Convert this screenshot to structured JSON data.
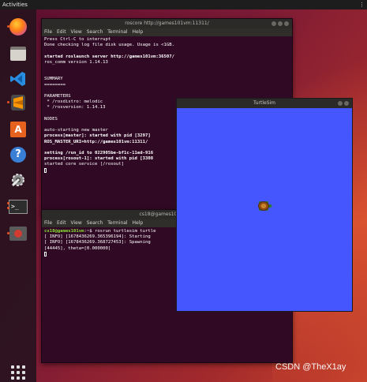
{
  "topbar": {
    "activities": "Activities",
    "tray": "⋮"
  },
  "dock": {
    "items": [
      {
        "name": "firefox",
        "icon": "firefox-icon"
      },
      {
        "name": "files",
        "icon": "files-icon"
      },
      {
        "name": "vscode",
        "icon": "vscode-icon"
      },
      {
        "name": "sublime",
        "icon": "sublime-icon"
      },
      {
        "name": "software",
        "icon": "software-icon",
        "glyph": "A"
      },
      {
        "name": "help",
        "icon": "help-icon",
        "glyph": "?"
      },
      {
        "name": "settings",
        "icon": "settings-icon"
      },
      {
        "name": "terminal",
        "icon": "terminal-icon",
        "glyph": ">_"
      },
      {
        "name": "turtlesim",
        "icon": "turtle-app-icon"
      },
      {
        "name": "apps",
        "icon": "app-grid-icon"
      }
    ]
  },
  "terminal1": {
    "title": "roscore http://games101vm:11311/",
    "menu": [
      "File",
      "Edit",
      "View",
      "Search",
      "Terminal",
      "Help"
    ],
    "lines": [
      "Press Ctrl-C to interrupt",
      "Done checking log file disk usage. Usage is <1GB.",
      "",
      "started roslaunch server http://games101vm:36507/",
      "ros_comm version 1.14.13",
      "",
      "",
      "SUMMARY",
      "========",
      "",
      "PARAMETERS",
      " * /rosdistro: melodic",
      " * /rosversion: 1.14.13",
      "",
      "NODES",
      "",
      "auto-starting new master",
      "process[master]: started with pid [3297]",
      "ROS_MASTER_URI=http://games101vm:11311/",
      "",
      "setting /run_id to 022905be-bf1c-11ed-916",
      "process[rosout-1]: started with pid [3308",
      "started core service [/rosout]"
    ]
  },
  "terminal2": {
    "title": "cs18@games101vm: ~",
    "menu": [
      "File",
      "Edit",
      "View",
      "Search",
      "Terminal",
      "Help"
    ],
    "prompt_user": "cs18@games101vm",
    "prompt_rest": ":~$ rosrun turtlesim turtle",
    "lines": [
      "[ INFO] [1678436269.365396194]: Starting",
      "[ INFO] [1678436269.368727453]: Spawning",
      "[44445], theta=[0.000000]"
    ]
  },
  "turtlesim": {
    "title": "TurtleSim"
  },
  "watermark": "CSDN @TheX1ay",
  "colors": {
    "terminal_bg": "#300a24",
    "turtlesim_bg": "#4556ff",
    "accent": "#e95420"
  }
}
